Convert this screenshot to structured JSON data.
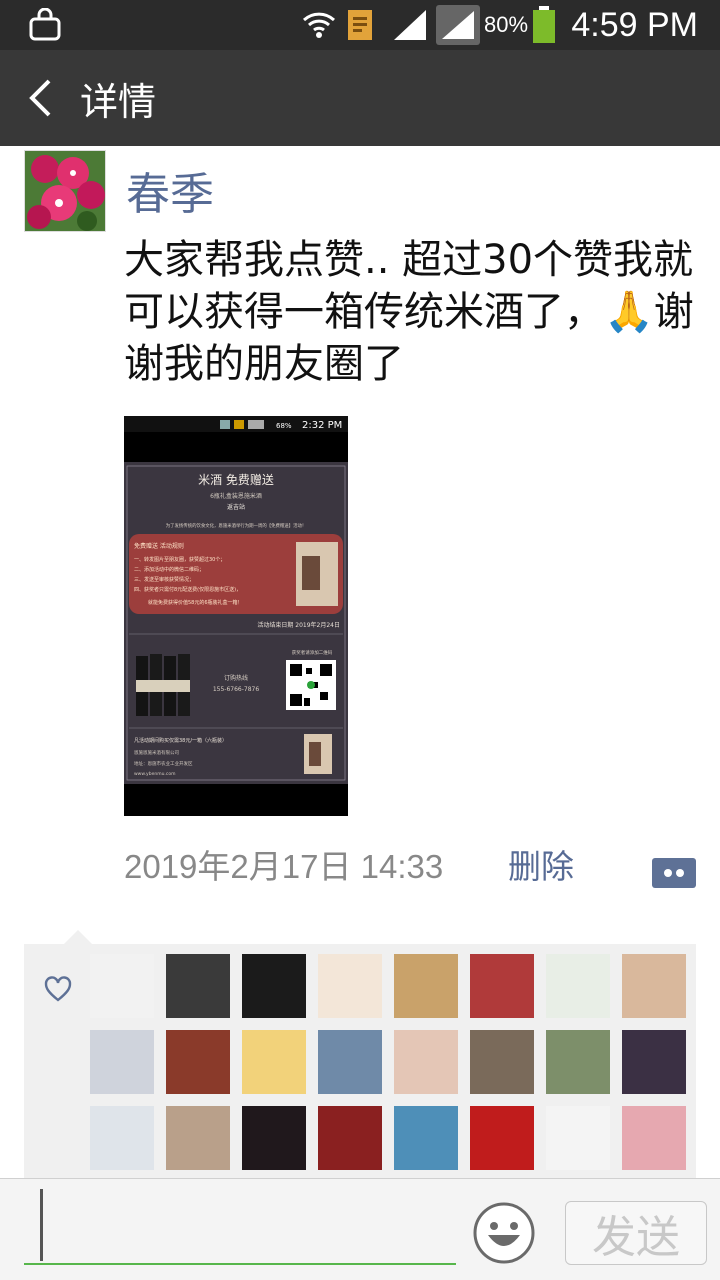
{
  "status_bar": {
    "battery_percent": "80%",
    "time": "4:59 PM"
  },
  "header": {
    "back_icon": "chevron-left-icon",
    "title": "详情"
  },
  "post": {
    "author": "春季",
    "text": "大家帮我点赞.. 超过30个赞我就可以获得一箱传统米酒了，🙏谢谢我的朋友圈了",
    "time": "2019年2月17日 14:33",
    "delete_label": "删除",
    "image": {
      "status_time": "2:32 PM",
      "status_battery": "68%",
      "poster_title": "米酒 免费赠送",
      "poster_subtitle": "6瓶礼盒装恩施米酒",
      "poster_tag": "返吉站",
      "poster_intro": "为了发扬传统的饮食文化，恩施米酒举行为期一周的【免费赠送】活动！",
      "rules_title": "免费赠送 活动规则",
      "rules": [
        "一、转发图片至朋友圈，获赞超过30个；",
        "二、添加活动中的微信二维码；",
        "三、发送至审核获赞情况；",
        "四、获奖者只需付8元配送费(仅限恩施市区送)，",
        "就能免费获得价值58元的6瓶装礼盒一箱！"
      ],
      "deadline": "活动结束日期 2019年2月24日",
      "hotline_label": "订购热线",
      "hotline": "155-6766-7876",
      "qr_label": "获奖者请添加二维码",
      "footer_line1": "凡活动期间购买仅需38元/一箱（六瓶装）",
      "footer_line2": "恩施恩施米酒有限公司",
      "footer_line3": "地址：恩施市农业工业开发区",
      "footer_line4": "www.ybenmu.com"
    }
  },
  "likes": {
    "heart_icon": "heart-outline-icon",
    "avatars": [
      {
        "color": "#f2f2f2"
      },
      {
        "color": "#3a3a3a"
      },
      {
        "color": "#1b1b1b"
      },
      {
        "color": "#f3e6d8"
      },
      {
        "color": "#c9a26a"
      },
      {
        "color": "#b03a3a"
      },
      {
        "color": "#e8eee6"
      },
      {
        "color": "#d9b89c"
      },
      {
        "color": "#cfd3dc"
      },
      {
        "color": "#8a3a2a"
      },
      {
        "color": "#f2d27a"
      },
      {
        "color": "#6f8aa8"
      },
      {
        "color": "#e4c6b6"
      },
      {
        "color": "#7a6a5a"
      },
      {
        "color": "#7d8f6a"
      },
      {
        "color": "#3b3044"
      },
      {
        "color": "#dfe4ea"
      },
      {
        "color": "#b9a08a"
      },
      {
        "color": "#20181c"
      },
      {
        "color": "#8a2020"
      },
      {
        "color": "#4e8fb8"
      },
      {
        "color": "#c01c1c"
      },
      {
        "color": "#f4f4f4"
      },
      {
        "color": "#e6a8b0"
      }
    ]
  },
  "input": {
    "emoji_icon": "emoji-smile-icon",
    "send_label": "发送"
  }
}
